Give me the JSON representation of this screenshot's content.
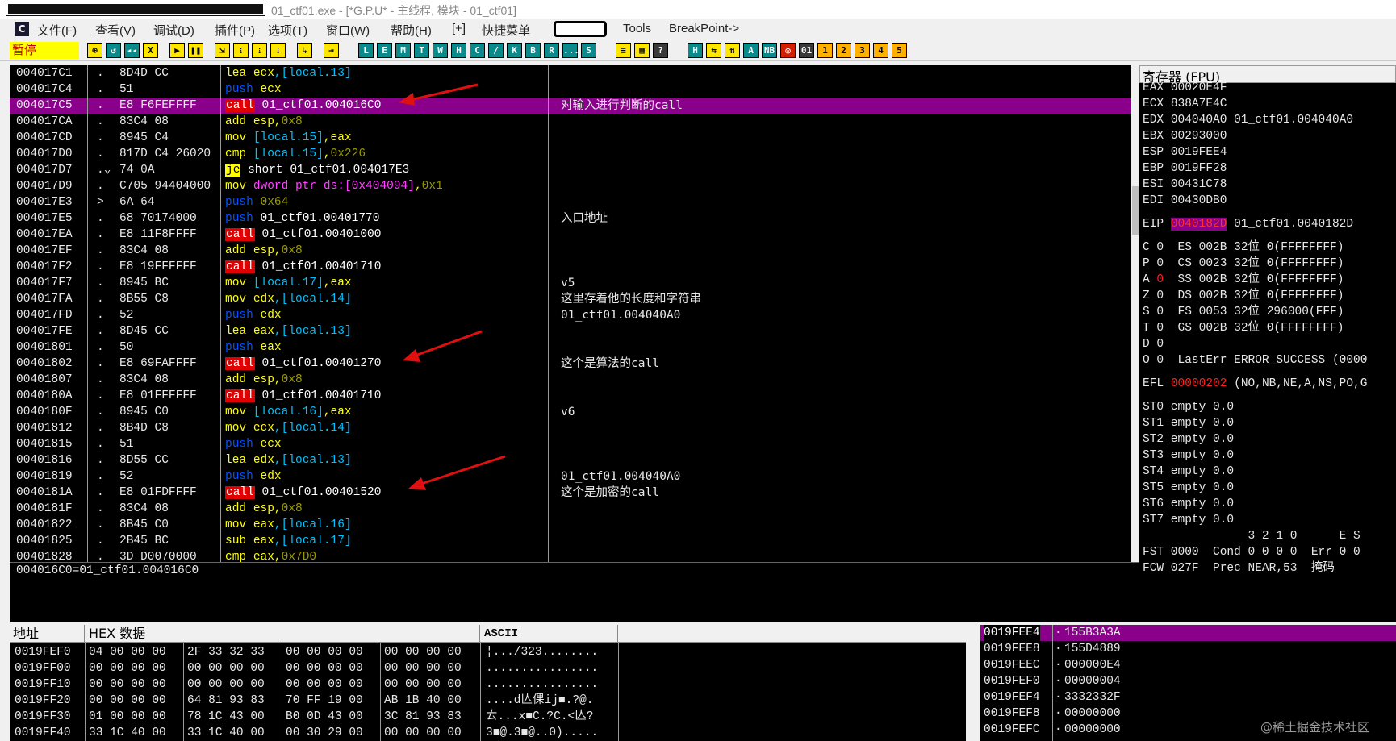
{
  "window": {
    "title": "01_ctf01.exe - [*G.P.U* - 主线程, 模块 - 01_ctf01]"
  },
  "menu": {
    "items": [
      "文件(F)",
      "查看(V)",
      "调试(D)",
      "插件(P)",
      "选项(T)",
      "窗口(W)",
      "帮助(H)",
      "[+]",
      "快捷菜单",
      "Tools",
      "BreakPoint->"
    ]
  },
  "toolbar": {
    "status": "暂停",
    "buttons": [
      "⊕",
      "↺",
      "◂◂",
      "X",
      "▶",
      "❚❚",
      "⇲",
      "⇣",
      "⇣",
      "⇣",
      "↳",
      "⇥",
      "L",
      "E",
      "M",
      "T",
      "W",
      "H",
      "C",
      "/",
      "K",
      "B",
      "R",
      "...",
      "S",
      "≡",
      "▦",
      "?",
      "H",
      "⇆",
      "⇅",
      "A",
      "NB",
      "◎",
      "01",
      "1",
      "2",
      "3",
      "4",
      "5"
    ]
  },
  "cpu": {
    "rows": [
      {
        "addr": "004017C1",
        "mark": ".",
        "hex": "8D4D CC",
        "asm": [
          {
            "t": "lea ",
            "c": "y"
          },
          {
            "t": "ecx",
            "c": "y"
          },
          {
            "t": ",[local.13]",
            "c": "br"
          }
        ],
        "comment": ""
      },
      {
        "addr": "004017C4",
        "mark": ".",
        "hex": "51",
        "asm": [
          {
            "t": "push ",
            "c": "push"
          },
          {
            "t": "ecx",
            "c": "y"
          }
        ],
        "comment": ""
      },
      {
        "addr": "004017C5",
        "mark": ".",
        "hex": "E8 F6FEFFFF",
        "asm": [
          {
            "t": "call",
            "c": "call"
          },
          {
            "t": " 01_ctf01.004016C0",
            "c": "w"
          }
        ],
        "comment": "对输入进行判断的call",
        "selected": true
      },
      {
        "addr": "004017CA",
        "mark": ".",
        "hex": "83C4 08",
        "asm": [
          {
            "t": "add ",
            "c": "y"
          },
          {
            "t": "esp",
            "c": "y"
          },
          {
            "t": ",",
            "c": "y"
          },
          {
            "t": "0x8",
            "c": "imm"
          }
        ],
        "comment": ""
      },
      {
        "addr": "004017CD",
        "mark": ".",
        "hex": "8945 C4",
        "asm": [
          {
            "t": "mov ",
            "c": "y"
          },
          {
            "t": "[local.15]",
            "c": "br"
          },
          {
            "t": ",eax",
            "c": "y"
          }
        ],
        "comment": ""
      },
      {
        "addr": "004017D0",
        "mark": ".",
        "hex": "817D C4 26020",
        "asm": [
          {
            "t": "cmp ",
            "c": "y"
          },
          {
            "t": "[local.15]",
            "c": "br"
          },
          {
            "t": ",",
            "c": "y"
          },
          {
            "t": "0x226",
            "c": "imm"
          }
        ],
        "comment": ""
      },
      {
        "addr": "004017D7",
        "mark": ".⌄",
        "hex": "74 0A",
        "asm": [
          {
            "t": "je",
            "c": "je"
          },
          {
            "t": " short 01_ctf01.004017E3",
            "c": "w"
          }
        ],
        "comment": ""
      },
      {
        "addr": "004017D9",
        "mark": ".",
        "hex": "C705 94404000",
        "asm": [
          {
            "t": "mov ",
            "c": "y"
          },
          {
            "t": "dword ptr ds:",
            "c": "mag"
          },
          {
            "t": "[0x404094]",
            "c": "mag"
          },
          {
            "t": ",",
            "c": "y"
          },
          {
            "t": "0x1",
            "c": "imm"
          }
        ],
        "comment": ""
      },
      {
        "addr": "004017E3",
        "mark": ">",
        "hex": "6A 64",
        "asm": [
          {
            "t": "push ",
            "c": "push"
          },
          {
            "t": "0x64",
            "c": "imm"
          }
        ],
        "comment": ""
      },
      {
        "addr": "004017E5",
        "mark": ".",
        "hex": "68 70174000",
        "asm": [
          {
            "t": "push ",
            "c": "push"
          },
          {
            "t": "01_ctf01.00401770",
            "c": "w"
          }
        ],
        "comment": "入口地址"
      },
      {
        "addr": "004017EA",
        "mark": ".",
        "hex": "E8 11F8FFFF",
        "asm": [
          {
            "t": "call",
            "c": "call"
          },
          {
            "t": " 01_ctf01.00401000",
            "c": "w"
          }
        ],
        "comment": ""
      },
      {
        "addr": "004017EF",
        "mark": ".",
        "hex": "83C4 08",
        "asm": [
          {
            "t": "add ",
            "c": "y"
          },
          {
            "t": "esp",
            "c": "y"
          },
          {
            "t": ",",
            "c": "y"
          },
          {
            "t": "0x8",
            "c": "imm"
          }
        ],
        "comment": ""
      },
      {
        "addr": "004017F2",
        "mark": ".",
        "hex": "E8 19FFFFFF",
        "asm": [
          {
            "t": "call",
            "c": "call"
          },
          {
            "t": " 01_ctf01.00401710",
            "c": "w"
          }
        ],
        "comment": ""
      },
      {
        "addr": "004017F7",
        "mark": ".",
        "hex": "8945 BC",
        "asm": [
          {
            "t": "mov ",
            "c": "y"
          },
          {
            "t": "[local.17]",
            "c": "br"
          },
          {
            "t": ",eax",
            "c": "y"
          }
        ],
        "comment": "v5"
      },
      {
        "addr": "004017FA",
        "mark": ".",
        "hex": "8B55 C8",
        "asm": [
          {
            "t": "mov ",
            "c": "y"
          },
          {
            "t": "edx",
            "c": "y"
          },
          {
            "t": ",[local.14]",
            "c": "br"
          }
        ],
        "comment": "这里存着他的长度和字符串"
      },
      {
        "addr": "004017FD",
        "mark": ".",
        "hex": "52",
        "asm": [
          {
            "t": "push ",
            "c": "push"
          },
          {
            "t": "edx",
            "c": "y"
          }
        ],
        "comment": "01_ctf01.004040A0"
      },
      {
        "addr": "004017FE",
        "mark": ".",
        "hex": "8D45 CC",
        "asm": [
          {
            "t": "lea ",
            "c": "y"
          },
          {
            "t": "eax",
            "c": "y"
          },
          {
            "t": ",[local.13]",
            "c": "br"
          }
        ],
        "comment": ""
      },
      {
        "addr": "00401801",
        "mark": ".",
        "hex": "50",
        "asm": [
          {
            "t": "push ",
            "c": "push"
          },
          {
            "t": "eax",
            "c": "y"
          }
        ],
        "comment": ""
      },
      {
        "addr": "00401802",
        "mark": ".",
        "hex": "E8 69FAFFFF",
        "asm": [
          {
            "t": "call",
            "c": "call"
          },
          {
            "t": " 01_ctf01.00401270",
            "c": "w"
          }
        ],
        "comment": "这个是算法的call"
      },
      {
        "addr": "00401807",
        "mark": ".",
        "hex": "83C4 08",
        "asm": [
          {
            "t": "add ",
            "c": "y"
          },
          {
            "t": "esp",
            "c": "y"
          },
          {
            "t": ",",
            "c": "y"
          },
          {
            "t": "0x8",
            "c": "imm"
          }
        ],
        "comment": ""
      },
      {
        "addr": "0040180A",
        "mark": ".",
        "hex": "E8 01FFFFFF",
        "asm": [
          {
            "t": "call",
            "c": "call"
          },
          {
            "t": " 01_ctf01.00401710",
            "c": "w"
          }
        ],
        "comment": ""
      },
      {
        "addr": "0040180F",
        "mark": ".",
        "hex": "8945 C0",
        "asm": [
          {
            "t": "mov ",
            "c": "y"
          },
          {
            "t": "[local.16]",
            "c": "br"
          },
          {
            "t": ",eax",
            "c": "y"
          }
        ],
        "comment": "v6"
      },
      {
        "addr": "00401812",
        "mark": ".",
        "hex": "8B4D C8",
        "asm": [
          {
            "t": "mov ",
            "c": "y"
          },
          {
            "t": "ecx",
            "c": "y"
          },
          {
            "t": ",[local.14]",
            "c": "br"
          }
        ],
        "comment": ""
      },
      {
        "addr": "00401815",
        "mark": ".",
        "hex": "51",
        "asm": [
          {
            "t": "push ",
            "c": "push"
          },
          {
            "t": "ecx",
            "c": "y"
          }
        ],
        "comment": ""
      },
      {
        "addr": "00401816",
        "mark": ".",
        "hex": "8D55 CC",
        "asm": [
          {
            "t": "lea ",
            "c": "y"
          },
          {
            "t": "edx",
            "c": "y"
          },
          {
            "t": ",[local.13]",
            "c": "br"
          }
        ],
        "comment": ""
      },
      {
        "addr": "00401819",
        "mark": ".",
        "hex": "52",
        "asm": [
          {
            "t": "push ",
            "c": "push"
          },
          {
            "t": "edx",
            "c": "y"
          }
        ],
        "comment": "01_ctf01.004040A0"
      },
      {
        "addr": "0040181A",
        "mark": ".",
        "hex": "E8 01FDFFFF",
        "asm": [
          {
            "t": "call",
            "c": "call"
          },
          {
            "t": " 01_ctf01.00401520",
            "c": "w"
          }
        ],
        "comment": "这个是加密的call"
      },
      {
        "addr": "0040181F",
        "mark": ".",
        "hex": "83C4 08",
        "asm": [
          {
            "t": "add ",
            "c": "y"
          },
          {
            "t": "esp",
            "c": "y"
          },
          {
            "t": ",",
            "c": "y"
          },
          {
            "t": "0x8",
            "c": "imm"
          }
        ],
        "comment": ""
      },
      {
        "addr": "00401822",
        "mark": ".",
        "hex": "8B45 C0",
        "asm": [
          {
            "t": "mov ",
            "c": "y"
          },
          {
            "t": "eax",
            "c": "y"
          },
          {
            "t": ",[local.16]",
            "c": "br"
          }
        ],
        "comment": ""
      },
      {
        "addr": "00401825",
        "mark": ".",
        "hex": "2B45 BC",
        "asm": [
          {
            "t": "sub ",
            "c": "y"
          },
          {
            "t": "eax",
            "c": "y"
          },
          {
            "t": ",[local.17]",
            "c": "br"
          }
        ],
        "comment": ""
      },
      {
        "addr": "00401828",
        "mark": ".",
        "hex": "3D D0070000",
        "asm": [
          {
            "t": "cmp ",
            "c": "y"
          },
          {
            "t": "eax",
            "c": "y"
          },
          {
            "t": ",",
            "c": "y"
          },
          {
            "t": "0x7D0",
            "c": "imm"
          }
        ],
        "comment": ""
      }
    ],
    "info_line": "004016C0=01_ctf01.004016C0"
  },
  "registers": {
    "header": "寄存器 (FPU)",
    "general": [
      {
        "name": "EAX",
        "value": "00020E4F",
        "note": ""
      },
      {
        "name": "ECX",
        "value": "838A7E4C",
        "note": ""
      },
      {
        "name": "EDX",
        "value": "004040A0",
        "note": "01_ctf01.004040A0"
      },
      {
        "name": "EBX",
        "value": "00293000",
        "note": ""
      },
      {
        "name": "ESP",
        "value": "0019FEE4",
        "note": ""
      },
      {
        "name": "EBP",
        "value": "0019FF28",
        "note": ""
      },
      {
        "name": "ESI",
        "value": "00431C78",
        "note": ""
      },
      {
        "name": "EDI",
        "value": "00430DB0",
        "note": ""
      }
    ],
    "eip": {
      "name": "EIP",
      "value": "0040182D",
      "note": "01_ctf01.0040182D"
    },
    "flags": [
      "C 0  ES 002B 32位 0(FFFFFFFF)",
      "P 0  CS 0023 32位 0(FFFFFFFF)",
      "A 0  SS 002B 32位 0(FFFFFFFF)",
      "Z 0  DS 002B 32位 0(FFFFFFFF)",
      "S 0  FS 0053 32位 296000(FFF)",
      "T 0  GS 002B 32位 0(FFFFFFFF)",
      "D 0",
      "O 0  LastErr ERROR_SUCCESS (0000"
    ],
    "efl": {
      "label": "EFL",
      "value": "00000202",
      "note": "(NO,NB,NE,A,NS,PO,G"
    },
    "fpu": [
      "ST0 empty 0.0",
      "ST1 empty 0.0",
      "ST2 empty 0.0",
      "ST3 empty 0.0",
      "ST4 empty 0.0",
      "ST5 empty 0.0",
      "ST6 empty 0.0",
      "ST7 empty 0.0"
    ],
    "fpu_hdr": "               3 2 1 0      E S",
    "fst": "FST 0000  Cond 0 0 0 0  Err 0 0",
    "fcw": "FCW 027F  Prec NEAR,53  掩码"
  },
  "dump": {
    "headers": {
      "addr": "地址",
      "hex": "HEX 数据",
      "ascii": "ASCII"
    },
    "rows": [
      {
        "addr": "0019FEF0",
        "hex": [
          "04 00 00 00",
          "2F 33 32 33",
          "00 00 00 00",
          "00 00 00 00"
        ],
        "ascii": "¦.../323........"
      },
      {
        "addr": "0019FF00",
        "hex": [
          "00 00 00 00",
          "00 00 00 00",
          "00 00 00 00",
          "00 00 00 00"
        ],
        "ascii": "................"
      },
      {
        "addr": "0019FF10",
        "hex": [
          "00 00 00 00",
          "00 00 00 00",
          "00 00 00 00",
          "00 00 00 00"
        ],
        "ascii": "................"
      },
      {
        "addr": "0019FF20",
        "hex": [
          "00 00 00 00",
          "64 81 93 83",
          "70 FF 19 00",
          "AB 1B 40 00"
        ],
        "ascii": "....d亾倮ij■.?@."
      },
      {
        "addr": "0019FF30",
        "hex": [
          "01 00 00 00",
          "78 1C 43 00",
          "B0 0D 43 00",
          "3C 81 93 83"
        ],
        "ascii": "ㄊ...x■C.?C.<亾?"
      },
      {
        "addr": "0019FF40",
        "hex": [
          "33 1C 40 00",
          "33 1C 40 00",
          "00 30 29 00",
          "00 00 00 00"
        ],
        "ascii": "3■@.3■@..0)....."
      }
    ]
  },
  "stack": {
    "rows": [
      {
        "addr": "0019FEE4",
        "value": "155B3A3A",
        "selected": true
      },
      {
        "addr": "0019FEE8",
        "value": "155D4889"
      },
      {
        "addr": "0019FEEC",
        "value": "000000E4"
      },
      {
        "addr": "0019FEF0",
        "value": "00000004"
      },
      {
        "addr": "0019FEF4",
        "value": "3332332F"
      },
      {
        "addr": "0019FEF8",
        "value": "00000000"
      },
      {
        "addr": "0019FEFC",
        "value": "00000000"
      }
    ]
  },
  "watermark": "@稀土掘金技术社区",
  "colors": {
    "selection": "#8a008a",
    "call_bg": "#e00000",
    "je_bg": "#ffff00",
    "pause_bg": "#ffff00",
    "arrow": "#e01010"
  }
}
